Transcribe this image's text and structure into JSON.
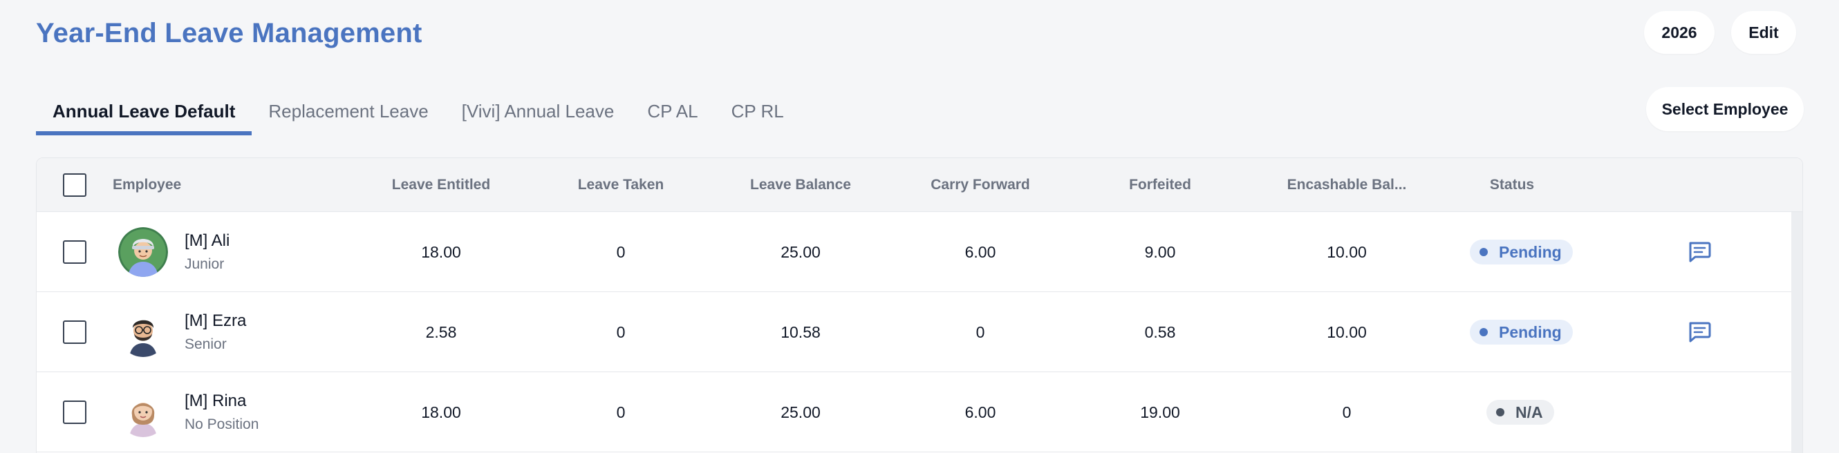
{
  "header": {
    "title": "Year-End Leave Management",
    "year_label": "2026",
    "edit_label": "Edit"
  },
  "tabs": [
    {
      "label": "Annual Leave Default",
      "active": true
    },
    {
      "label": "Replacement Leave",
      "active": false
    },
    {
      "label": "[Vivi] Annual Leave",
      "active": false
    },
    {
      "label": "CP AL",
      "active": false
    },
    {
      "label": "CP RL",
      "active": false
    }
  ],
  "select_employee_label": "Select Employee",
  "table": {
    "columns": {
      "employee": "Employee",
      "entitled": "Leave Entitled",
      "taken": "Leave Taken",
      "balance": "Leave Balance",
      "carry": "Carry Forward",
      "forfeited": "Forfeited",
      "encashable": "Encashable Bal...",
      "status": "Status"
    },
    "rows": [
      {
        "name": "[M] Ali",
        "position": "Junior",
        "entitled": "18.00",
        "taken": "0",
        "balance": "25.00",
        "carry": "6.00",
        "forfeited": "9.00",
        "encashable": "10.00",
        "status": "Pending",
        "has_comment": true
      },
      {
        "name": "[M] Ezra",
        "position": "Senior",
        "entitled": "2.58",
        "taken": "0",
        "balance": "10.58",
        "carry": "0",
        "forfeited": "0.58",
        "encashable": "10.00",
        "status": "Pending",
        "has_comment": true
      },
      {
        "name": "[M] Rina",
        "position": "No Position",
        "entitled": "18.00",
        "taken": "0",
        "balance": "25.00",
        "carry": "6.00",
        "forfeited": "19.00",
        "encashable": "0",
        "status": "N/A",
        "has_comment": false
      }
    ]
  },
  "colors": {
    "accent": "#4a74c0",
    "pending_bg": "#e8effa",
    "na_bg": "#eef0f3"
  },
  "icons": {
    "comment": "comment-icon",
    "avatars": [
      "avatar-ali",
      "avatar-ezra",
      "avatar-rina"
    ]
  }
}
